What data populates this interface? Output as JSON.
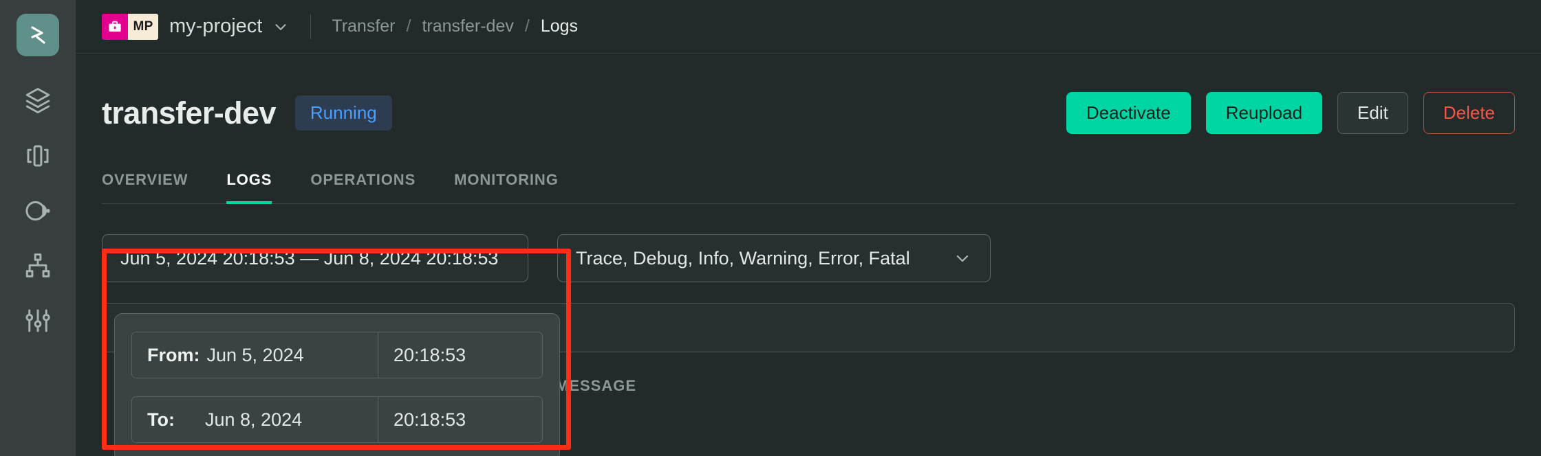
{
  "rail": {
    "logo_name": "platform-logo",
    "items": [
      {
        "icon": "layers-stack-icon",
        "name": "sidebar-item-deployments"
      },
      {
        "icon": "brackets-module-icon",
        "name": "sidebar-item-services"
      },
      {
        "icon": "contrast-circles-icon",
        "name": "sidebar-item-environments"
      },
      {
        "icon": "hierarchy-tree-icon",
        "name": "sidebar-item-topology"
      },
      {
        "icon": "sliders-settings-icon",
        "name": "sidebar-item-settings"
      }
    ]
  },
  "header": {
    "project_icon": "briefcase-icon",
    "project_initials": "MP",
    "project_name": "my-project",
    "project_caret_icon": "chevron-down-icon",
    "breadcrumb": [
      {
        "label": "Transfer",
        "active": false
      },
      {
        "label": "transfer-dev",
        "active": false
      },
      {
        "label": "Logs",
        "active": true
      }
    ],
    "breadcrumb_separator": "/"
  },
  "page": {
    "title": "transfer-dev",
    "status_badge": "Running",
    "actions": [
      {
        "label": "Deactivate",
        "style": "primary",
        "name": "deactivate-button"
      },
      {
        "label": "Reupload",
        "style": "primary",
        "name": "reupload-button"
      },
      {
        "label": "Edit",
        "style": "ghost",
        "name": "edit-button"
      },
      {
        "label": "Delete",
        "style": "danger",
        "name": "delete-button"
      }
    ],
    "tabs": [
      {
        "label": "OVERVIEW",
        "active": false
      },
      {
        "label": "LOGS",
        "active": true
      },
      {
        "label": "OPERATIONS",
        "active": false
      },
      {
        "label": "MONITORING",
        "active": false
      }
    ]
  },
  "filters": {
    "date_range_value": "Jun 5, 2024 20:18:53 — Jun 8, 2024 20:18:53",
    "levels_value": "Trace, Debug, Info, Warning, Error, Fatal",
    "levels_caret_icon": "chevron-down-icon",
    "search_value": "",
    "search_placeholder": ""
  },
  "date_picker": {
    "from_label": "From:",
    "from_date": "Jun 5, 2024",
    "from_time": "20:18:53",
    "to_label": "To:",
    "to_date": "Jun 8, 2024",
    "to_time": "20:18:53"
  },
  "log_table": {
    "columns": [
      {
        "label": "MESSAGE",
        "name": "column-header-message"
      }
    ]
  },
  "colors": {
    "accent_teal": "#00d6a4",
    "logo_teal": "#5f918a",
    "status_blue": "#4a9eff",
    "status_blue_bg": "#2d3c50",
    "danger_red": "#f0564a",
    "highlight_red": "#ff2d16",
    "project_magenta": "#e4008f",
    "initials_cream": "#f7ecd7",
    "rail_bg": "#373e3d",
    "main_bg": "#222b2a",
    "panel_bg": "#3a4342",
    "field_bg": "#27302f",
    "text_primary": "#e8eceb",
    "text_muted": "#8c9895"
  }
}
